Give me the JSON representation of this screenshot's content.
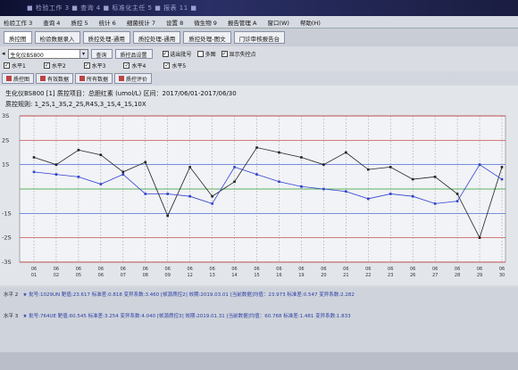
{
  "titlebar": {
    "text": "■ 检验工作 3 ■ 查询 4 ■ 标准化主任 5 ■ 报表 11 ■"
  },
  "menubar": [
    "检验工作 3",
    "查询 4",
    "质控 5",
    "统计 6",
    "细菌统计 7",
    "设置 8",
    "微生物 9",
    "报告管理 A",
    "窗口(W)",
    "帮助(H)"
  ],
  "tabs": [
    "质控图",
    "检验数据录入",
    "质控处理-通用",
    "质控处理-通用",
    "质控处理-图文",
    "门诊审核报告台"
  ],
  "toolbar": {
    "device": "生化仪BS800",
    "query_button": "查询",
    "device_summary_button": "质控品设置",
    "checks": [
      {
        "label": "水平1",
        "checked": true
      },
      {
        "label": "水平2",
        "checked": true
      },
      {
        "label": "水平3",
        "checked": true
      },
      {
        "label": "水平4",
        "checked": true
      },
      {
        "label": "水平5",
        "checked": true
      }
    ],
    "right_checks": [
      {
        "label": "选出批号",
        "checked": true
      },
      {
        "label": "多图",
        "checked": false
      },
      {
        "label": "显示失控点",
        "checked": true
      }
    ]
  },
  "subtabs": [
    "质控图",
    "有效数据",
    "所有数据",
    "质控评价"
  ],
  "chart": {
    "header": "生化仪BS800 [1] 质控项目：总胆红素 (umol/L) 区间：2017/06/01-2017/06/30",
    "rules": "质控规则: 1_2S,1_3S,2_2S,R4S,3_1S,4_1S,10X",
    "y_labels": [
      "3S",
      "2S",
      "1S",
      "",
      "-1S",
      "-2S",
      "-3S"
    ]
  },
  "chart_data": {
    "type": "line",
    "x_labels": [
      "06/01",
      "06/02",
      "06/05",
      "06/06",
      "06/07",
      "06/08",
      "06/09",
      "06/12",
      "06/13",
      "06/14",
      "06/15",
      "06/16",
      "06/19",
      "06/20",
      "06/21",
      "06/22",
      "06/23",
      "06/26",
      "06/27",
      "06/28",
      "06/29",
      "06/30"
    ],
    "ylim": [
      -3,
      3
    ],
    "series": [
      {
        "color": "#222222",
        "values": [
          1.3,
          1.0,
          1.6,
          1.4,
          0.7,
          1.1,
          -1.1,
          0.9,
          -0.3,
          0.3,
          1.7,
          1.5,
          1.3,
          1.0,
          1.5,
          0.8,
          0.9,
          0.4,
          0.5,
          -0.2,
          -2.0,
          0.9
        ]
      },
      {
        "color": "#2f3fcf",
        "values": [
          0.7,
          0.6,
          0.5,
          0.2,
          0.6,
          -0.2,
          -0.2,
          -0.3,
          -0.6,
          0.9,
          0.6,
          0.3,
          0.1,
          0.0,
          -0.1,
          -0.4,
          -0.2,
          -0.3,
          -0.6,
          -0.5,
          1.0,
          0.4
        ]
      }
    ]
  },
  "footer": {
    "level2_label": "水平 2",
    "level2_text": "★ 批号:1029UN  靶值:23.617  标准差:0.818  变异系数:3.460  [帧源质控2]  效期:2019.03.01  [当前数据]均值：23.973  标准差:0.547  变异系数:2.282",
    "level3_label": "水平 3",
    "level3_text": "★ 批号:764UE  靶值:60.545  标准差:3.254  变异系数:4.040  [帧源质控3]  效期:2019.01.31  [当前数据]均值：60.768  标准差:1.481  变异系数:1.833"
  }
}
